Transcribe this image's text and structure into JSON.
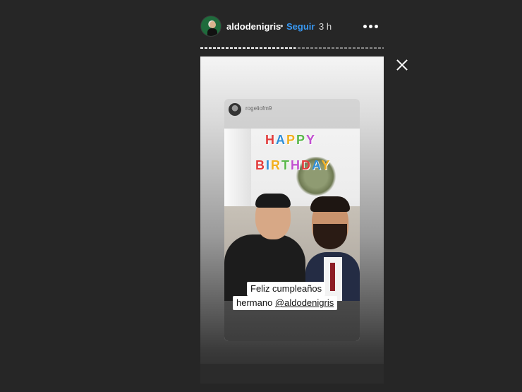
{
  "header": {
    "username": "aldodenigris",
    "separator": "•",
    "follow_label": "Seguir",
    "time_ago": "3 h",
    "more_icon": "more-options-icon"
  },
  "progress": {
    "value": 0.52
  },
  "close_icon": "close-icon",
  "story": {
    "shared_post": {
      "username": "rogeliofm9",
      "sticker_line1": "HAPPY",
      "sticker_line2": "BIRTHDAY"
    },
    "caption": {
      "line1": "Feliz cumpleaños",
      "line2_prefix": "hermano ",
      "mention": "@aldodenigris"
    }
  },
  "colors": {
    "background": "#262626",
    "link_blue": "#3897f0"
  }
}
